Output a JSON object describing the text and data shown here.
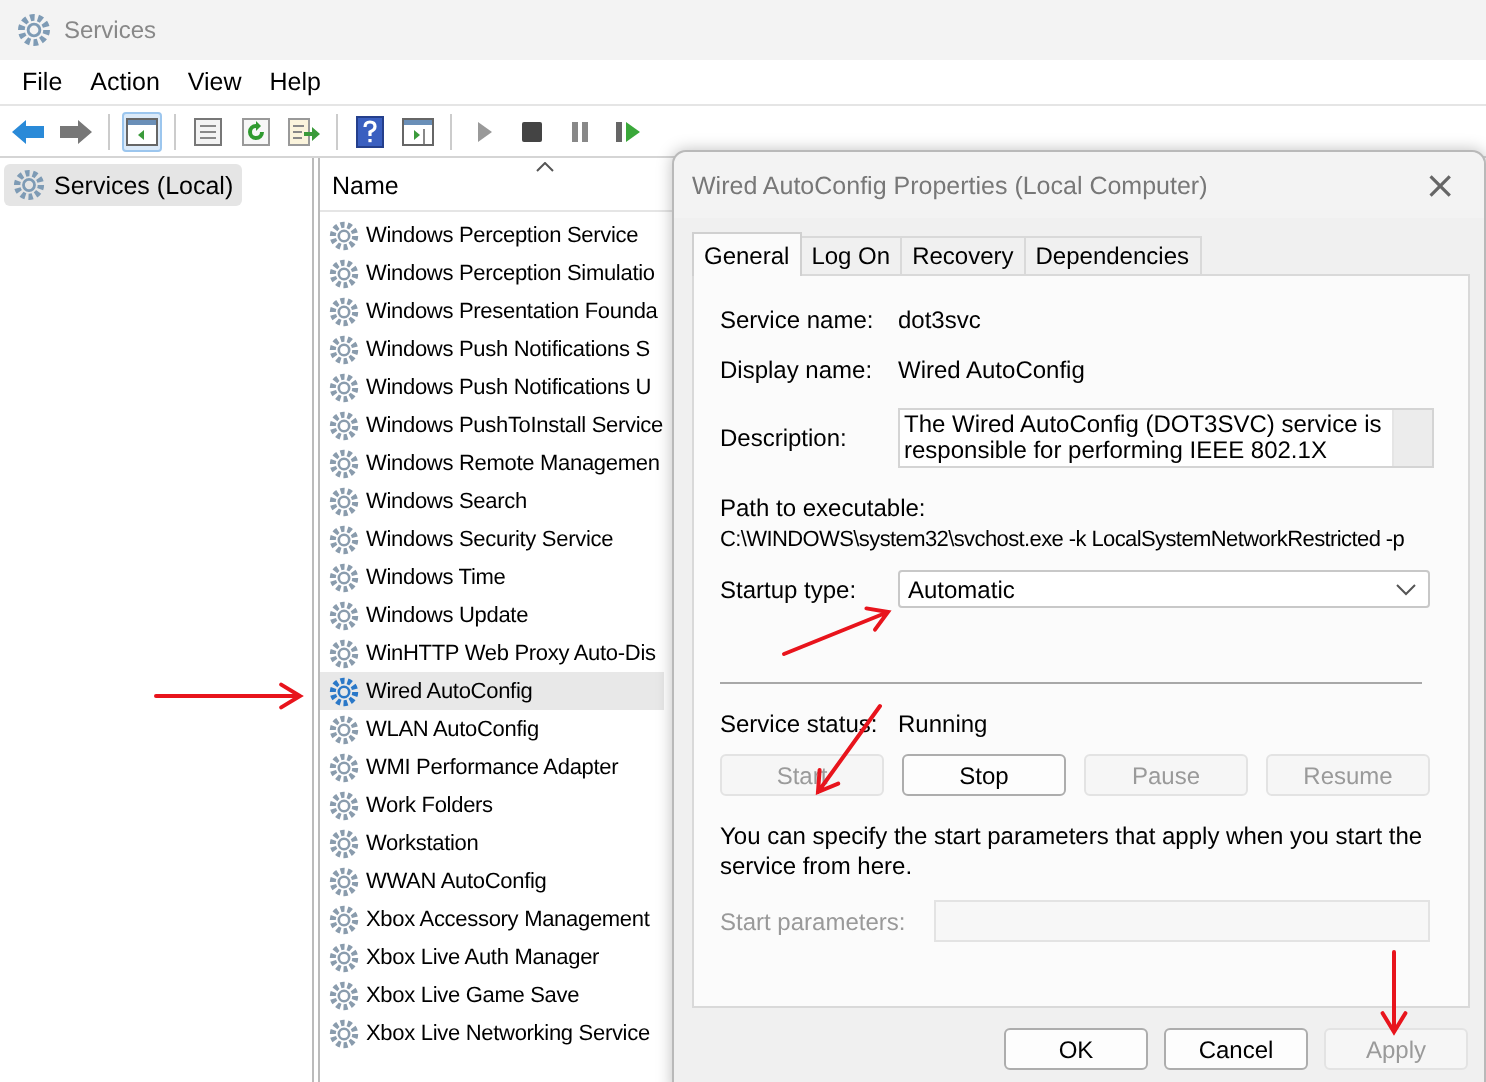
{
  "window": {
    "title": "Services"
  },
  "menu": [
    "File",
    "Action",
    "View",
    "Help"
  ],
  "tree": {
    "items": [
      {
        "label": "Services (Local)",
        "selected": true
      }
    ]
  },
  "list": {
    "columns": [
      {
        "label": "Name",
        "sorted": true
      }
    ],
    "rows": [
      {
        "name": "Windows Perception Service",
        "selected": false
      },
      {
        "name": "Windows Perception Simulatio",
        "selected": false
      },
      {
        "name": "Windows Presentation Founda",
        "selected": false
      },
      {
        "name": "Windows Push Notifications S",
        "selected": false
      },
      {
        "name": "Windows Push Notifications U",
        "selected": false
      },
      {
        "name": "Windows PushToInstall Service",
        "selected": false
      },
      {
        "name": "Windows Remote Managemen",
        "selected": false
      },
      {
        "name": "Windows Search",
        "selected": false
      },
      {
        "name": "Windows Security Service",
        "selected": false
      },
      {
        "name": "Windows Time",
        "selected": false
      },
      {
        "name": "Windows Update",
        "selected": false
      },
      {
        "name": "WinHTTP Web Proxy Auto-Dis",
        "selected": false
      },
      {
        "name": "Wired AutoConfig",
        "selected": true
      },
      {
        "name": "WLAN AutoConfig",
        "selected": false
      },
      {
        "name": "WMI Performance Adapter",
        "selected": false
      },
      {
        "name": "Work Folders",
        "selected": false
      },
      {
        "name": "Workstation",
        "selected": false
      },
      {
        "name": "WWAN AutoConfig",
        "selected": false
      },
      {
        "name": "Xbox Accessory Management",
        "selected": false
      },
      {
        "name": "Xbox Live Auth Manager",
        "selected": false
      },
      {
        "name": "Xbox Live Game Save",
        "selected": false
      },
      {
        "name": "Xbox Live Networking Service",
        "selected": false
      }
    ]
  },
  "dialog": {
    "title": "Wired AutoConfig Properties (Local Computer)",
    "close": "×",
    "tabs": [
      {
        "label": "General",
        "selected": true
      },
      {
        "label": "Log On",
        "selected": false
      },
      {
        "label": "Recovery",
        "selected": false
      },
      {
        "label": "Dependencies",
        "selected": false
      }
    ],
    "fields": [
      {
        "label": "Service name:",
        "value": "dot3svc"
      },
      {
        "label": "Display name:",
        "value": "Wired AutoConfig"
      }
    ],
    "description": {
      "label": "Description:",
      "text": "The Wired AutoConfig (DOT3SVC) service is responsible for performing IEEE 802.1X"
    },
    "path": {
      "label": "Path to executable:",
      "value": "C:\\WINDOWS\\system32\\svchost.exe -k LocalSystemNetworkRestricted -p"
    },
    "startup_type": {
      "label": "Startup type:",
      "value": "Automatic"
    },
    "service_status": {
      "label": "Service status:",
      "value": "Running"
    },
    "service_buttons": [
      {
        "label": "Start",
        "disabled": true
      },
      {
        "label": "Stop",
        "disabled": false
      },
      {
        "label": "Pause",
        "disabled": true
      },
      {
        "label": "Resume",
        "disabled": true
      }
    ],
    "hint": "You can specify the start parameters that apply when you start the service from here.",
    "start_parameters": {
      "label": "Start parameters:",
      "disabled": true
    },
    "buttons": [
      {
        "label": "OK",
        "disabled": false
      },
      {
        "label": "Cancel",
        "disabled": false
      },
      {
        "label": "Apply",
        "disabled": true
      }
    ]
  }
}
